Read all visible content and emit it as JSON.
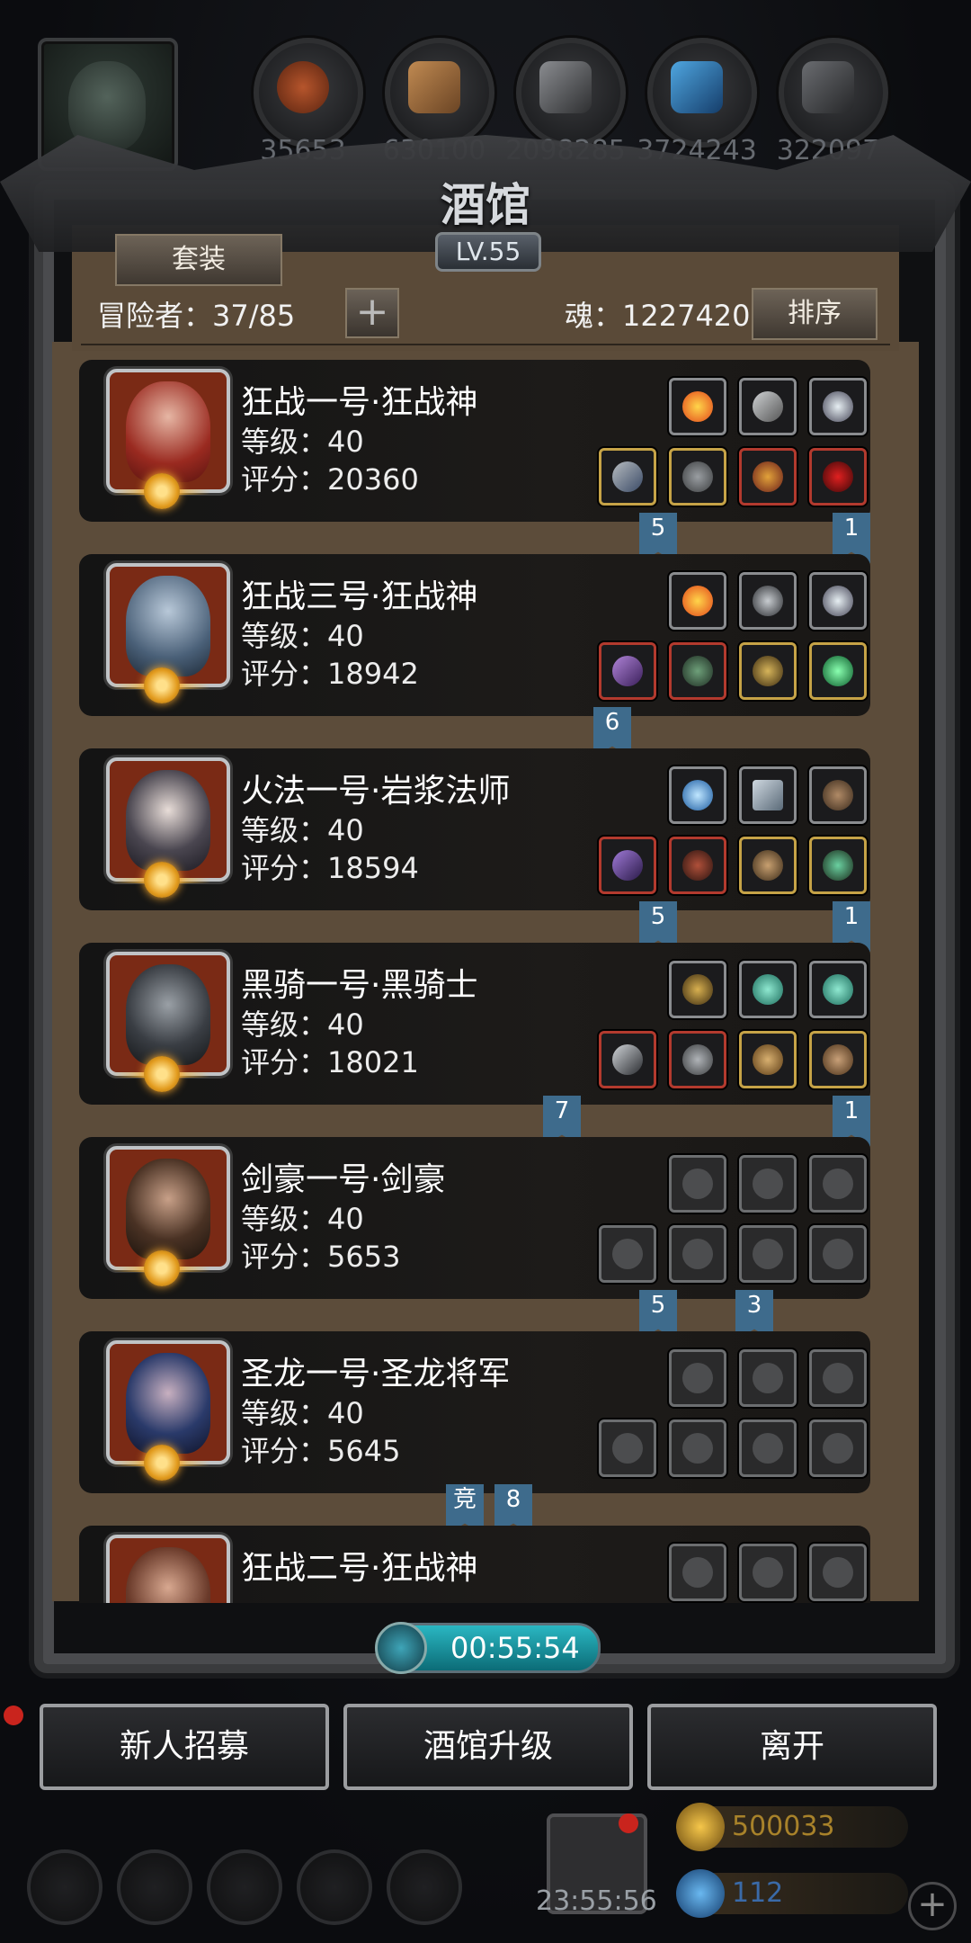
{
  "resources": [
    "35653",
    "630100",
    "2098285",
    "3724243",
    "322097"
  ],
  "tavern": {
    "title": "酒馆",
    "level": "LV.55",
    "set_button": "套装",
    "adventurers": "冒险者：37/85",
    "soul": "魂：1227420",
    "sort_button": "排序",
    "plus": "+"
  },
  "heroes": [
    {
      "name": "狂战一号·狂战神",
      "level": "等级：40",
      "score": "评分：20360",
      "ribbons": [
        "5",
        "1"
      ]
    },
    {
      "name": "狂战三号·狂战神",
      "level": "等级：40",
      "score": "评分：18942",
      "ribbons": [
        "6"
      ]
    },
    {
      "name": "火法一号·岩浆法师",
      "level": "等级：40",
      "score": "评分：18594",
      "ribbons": [
        "5",
        "1"
      ]
    },
    {
      "name": "黑骑一号·黑骑士",
      "level": "等级：40",
      "score": "评分：18021",
      "ribbons": [
        "7",
        "1"
      ]
    },
    {
      "name": "剑豪一号·剑豪",
      "level": "等级：40",
      "score": "评分：5653",
      "ribbons": [
        "5",
        "3"
      ]
    },
    {
      "name": "圣龙一号·圣龙将军",
      "level": "等级：40",
      "score": "评分：5645",
      "ribbons": [
        "竞",
        "8"
      ]
    },
    {
      "name": "狂战二号·狂战神",
      "level": "",
      "score": "",
      "ribbons": []
    }
  ],
  "timer": "00:55:54",
  "actions": {
    "recruit": "新人招募",
    "upgrade": "酒馆升级",
    "leave": "离开"
  },
  "gift_timer": "23:55:56",
  "currencies": {
    "gold": "500033",
    "gem": "112"
  },
  "colors": {
    "ribbon": "#3e6b8c",
    "frame_wood": "#5c4c3a",
    "timer": "#2ab7c2"
  }
}
